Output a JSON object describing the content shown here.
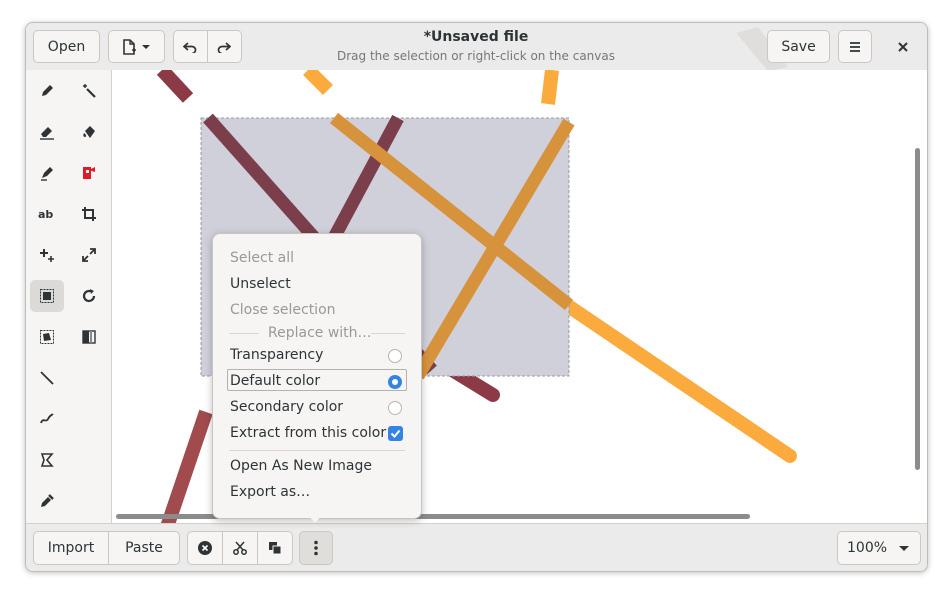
{
  "header": {
    "open_label": "Open",
    "title": "*Unsaved file",
    "subtitle": "Drag the selection or right-click on the canvas",
    "save_label": "Save"
  },
  "bottom": {
    "import_label": "Import",
    "paste_label": "Paste",
    "zoom": "100%"
  },
  "menu": {
    "select_all": "Select all",
    "unselect": "Unselect",
    "close_selection": "Close selection",
    "replace_with": "Replace with…",
    "transparency": "Transparency",
    "default_color": "Default color",
    "secondary_color": "Secondary color",
    "extract_color": "Extract from this color",
    "open_new_image": "Open As New Image",
    "export_as": "Export as…"
  },
  "colors": {
    "accent": "#3584e4",
    "stroke_dark": "#8b3a46",
    "stroke_orange": "#fbab3d",
    "selection_tint": "#c9c9d6"
  }
}
